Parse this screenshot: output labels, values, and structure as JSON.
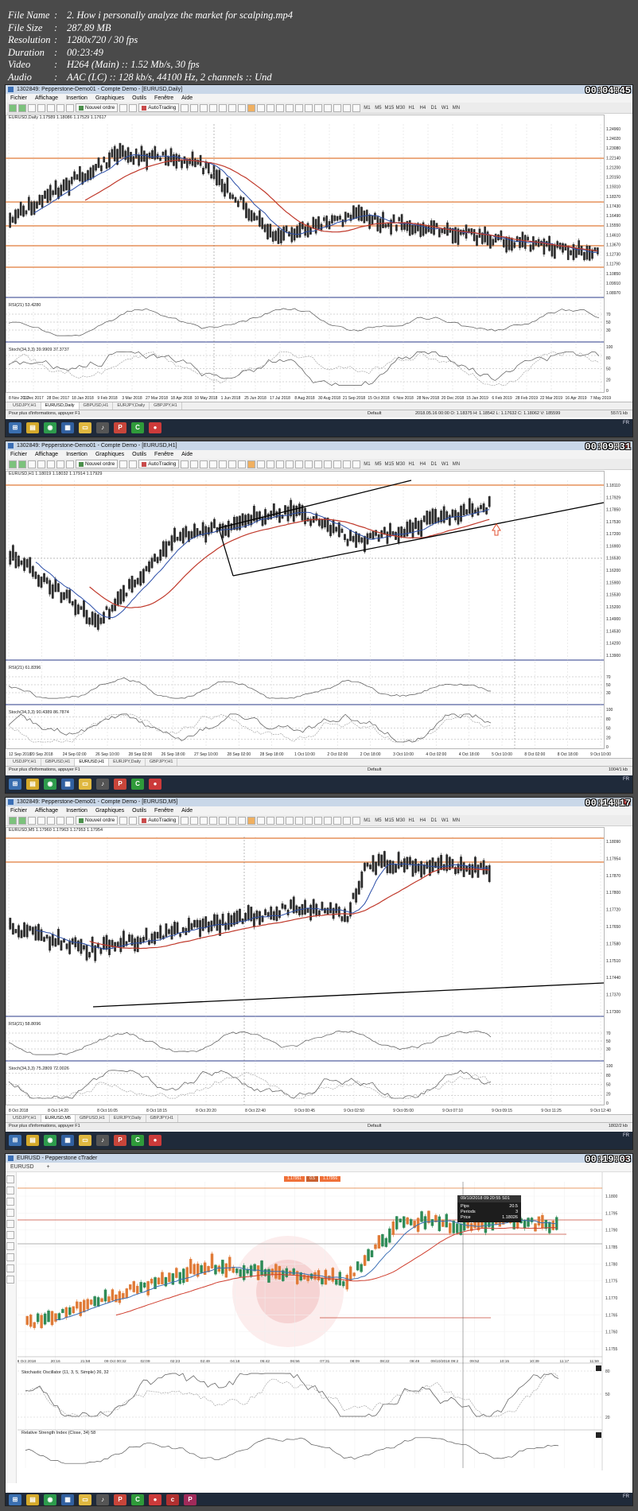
{
  "file_info": [
    {
      "key": "File Name",
      "value": "2. How i personally analyze the market for scalping.mp4"
    },
    {
      "key": "File Size",
      "value": "287.89 MB"
    },
    {
      "key": "Resolution",
      "value": "1280x720 / 30 fps"
    },
    {
      "key": "Duration",
      "value": "00:23:49"
    },
    {
      "key": "Video",
      "value": "H264 (Main) :: 1.52 Mb/s, 30 fps"
    },
    {
      "key": "Audio",
      "value": "AAC (LC) :: 128 kb/s, 44100 Hz, 2 channels :: Und"
    }
  ],
  "mt4": {
    "menus": [
      "Fichier",
      "Affichage",
      "Insertion",
      "Graphiques",
      "Outils",
      "Fenêtre",
      "Aide"
    ],
    "new_order": "Nouvel ordre",
    "autotrading": "AutoTrading",
    "timeframes": [
      "M1",
      "M5",
      "M15",
      "M30",
      "H1",
      "H4",
      "D1",
      "W1",
      "MN"
    ],
    "status_help": "Pour plus d'informations, appuyer F1",
    "status_profile": "Default",
    "tray_lang": "FR"
  },
  "frames": [
    {
      "timestamp": "00:04:45",
      "title": "1302849: Pepperstone-Demo01 - Compte Demo - [EURUSD,Daily]",
      "symbol_label": "EURUSD,Daily 1.17589 1.18086 1.17529 1.17617",
      "rsi_label": "RSI(21) 53.4280",
      "stoch_label": "Stoch(34,3,3) 39.9909 37.3737",
      "rsi_levels": [
        "70",
        "50",
        "30"
      ],
      "stoch_levels": [
        "100",
        "80",
        "50",
        "20",
        "0"
      ],
      "price_levels": [
        "1.24960",
        "1.24020",
        "1.23080",
        "1.22140",
        "1.21200",
        "1.20150",
        "1.19310",
        "1.18370",
        "1.17430",
        "1.16490",
        "1.15550",
        "1.14610",
        "1.13670",
        "1.12730",
        "1.11790",
        "1.10850",
        "1.09910",
        "1.08970"
      ],
      "x_labels": [
        "8 Nov 2017",
        "1 Dec 2017",
        "28 Dec 2017",
        "18 Jan 2018",
        "9 Feb 2018",
        "3 Mar 2018",
        "27 Mar 2018",
        "18 Apr 2018",
        "10 May 2018",
        "1 Jun 2018",
        "25 Jun 2018",
        "17 Jul 2018",
        "8 Aug 2018",
        "30 Aug 2018",
        "21 Sep 2018",
        "15 Oct 2018",
        "6 Nov 2018",
        "28 Nov 2018",
        "20 Dec 2018",
        "15 Jan 2019",
        "6 Feb 2019",
        "28 Feb 2019",
        "22 Mar 2019",
        "16 Apr 2019",
        "7 May 2019"
      ],
      "tabs": [
        "USDJPY,H1",
        "EURUSD,Daily",
        "GBPUSD,H1",
        "EURJPY,Daily",
        "GBPJPY,H1"
      ],
      "active_tab": 1,
      "status_ohlc": "2018.05.16 00:00  O: 1.18375  H: 1.18542  L: 1.17632  C: 1.18062  V: 185599",
      "status_size": "557/1 kb"
    },
    {
      "timestamp": "00:09:31",
      "title": "1302849: Pepperstone-Demo01 - Compte Demo - [EURUSD,H1]",
      "symbol_label": "EURUSD,H1 1.18019 1.18032 1.17914 1.17929",
      "rsi_label": "RSI(21) 61.8396",
      "stoch_label": "Stoch(34,3,3) 90.4389 86.7874",
      "rsi_levels": [
        "70",
        "50",
        "30"
      ],
      "stoch_levels": [
        "100",
        "80",
        "50",
        "20",
        "0"
      ],
      "price_levels": [
        "1.18110",
        "1.17929",
        "1.17850",
        "1.17530",
        "1.17200",
        "1.16900",
        "1.16530",
        "1.16200",
        "1.15900",
        "1.15530",
        "1.15200",
        "1.14900",
        "1.14530",
        "1.14200",
        "1.13900"
      ],
      "x_labels": [
        "12 Sep 2018",
        "20 Sep 2018",
        "24 Sep 02:00",
        "26 Sep 10:00",
        "28 Sep 02:00",
        "26 Sep 18:00",
        "27 Sep 10:00",
        "28 Sep 02:00",
        "28 Sep 18:00",
        "1 Oct 10:00",
        "2 Oct 02:00",
        "2 Oct 18:00",
        "3 Oct 10:00",
        "4 Oct 02:00",
        "4 Oct 18:00",
        "5 Oct 10:00",
        "8 Oct 02:00",
        "8 Oct 18:00",
        "9 Oct 10:00"
      ],
      "tabs": [
        "USDJPY,H1",
        "GBPUSD,H1",
        "EURUSD,H1",
        "EURJPY,Daily",
        "GBPJPY,H1"
      ],
      "active_tab": 2,
      "status_size": "1004/1 kb"
    },
    {
      "timestamp": "00:14:17",
      "title": "1302849: Pepperstone-Demo01 - Compte Demo - [EURUSD,M5]",
      "symbol_label": "EURUSD,M5 1.17960 1.17963 1.17953 1.17954",
      "rsi_label": "RSI(21) 58.8096",
      "stoch_label": "Stoch(34,3,3) 75.2809 72.0026",
      "rsi_levels": [
        "70",
        "50",
        "30"
      ],
      "stoch_levels": [
        "100",
        "80",
        "50",
        "20",
        "0"
      ],
      "price_levels": [
        "1.18090",
        "1.17954",
        "1.17870",
        "1.17800",
        "1.17720",
        "1.17650",
        "1.17580",
        "1.17510",
        "1.17440",
        "1.17370",
        "1.17300"
      ],
      "x_labels": [
        "8 Oct 2018",
        "8 Oct 14:20",
        "8 Oct 16:05",
        "8 Oct 18:15",
        "8 Oct 20:20",
        "8 Oct 22:40",
        "9 Oct 00:45",
        "9 Oct 02:50",
        "9 Oct 05:00",
        "9 Oct 07:10",
        "9 Oct 09:15",
        "9 Oct 11:25",
        "9 Oct 12:40"
      ],
      "tabs": [
        "USDJPY,H1",
        "EURUSD,M5",
        "GBPUSD,H1",
        "EURJPY,Daily",
        "GBPJPY,H1"
      ],
      "active_tab": 1,
      "status_size": "1802/2 kb"
    },
    {
      "timestamp": "00:19:03",
      "title": "EURUSD - Pepperstone cTrader",
      "symbol_label": "EURUSD",
      "price_buttons": [
        "1.17951",
        "0.5",
        "1.17956"
      ],
      "tooltip": {
        "header": "09/10/2018 09:20:55 S01",
        "rows": [
          [
            "Pips",
            "20.5"
          ],
          [
            "Periods",
            "3"
          ],
          [
            "Price",
            "1.18026"
          ]
        ]
      },
      "price_levels": [
        "1.1800",
        "1.1795",
        "1.1790",
        "1.1785",
        "1.1780",
        "1.1775",
        "1.1770",
        "1.1765",
        "1.1760",
        "1.1755"
      ],
      "x_labels": [
        "08 Oct 2018",
        "20:16",
        "21:58",
        "09 Oct 00:32",
        "02:09",
        "02:23",
        "02:49",
        "04:18",
        "05:42",
        "06:56",
        "07:31",
        "08:09",
        "08:22",
        "08:49",
        "09/10/2018 09:2",
        "09:52",
        "10:15",
        "10:39",
        "11:17",
        "11:59"
      ],
      "stoch_label": "Stochastic Oscillator (11, 3, 5, Simple) 26, 32",
      "rsi_label": "Relative Strength Index (Close, 34) 58",
      "indicator_levels": [
        "80",
        "50",
        "20"
      ]
    }
  ],
  "colors": {
    "candle": "#2b2b2b",
    "ma_fast": "#2b4ea8",
    "ma_slow": "#c0392b",
    "level": "#e07b39",
    "grid": "#d8d8d8",
    "ct_bull": "#2e8b57",
    "ct_bear": "#e07a36"
  }
}
